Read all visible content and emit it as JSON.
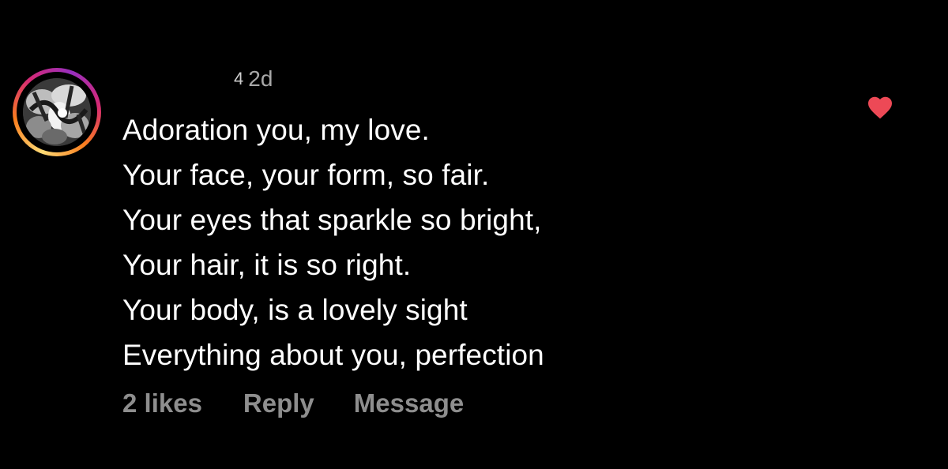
{
  "comment": {
    "username_fragment": "4",
    "timestamp": "2d",
    "lines": [
      "Adoration you, my love.",
      "Your face, your form, so fair.",
      "Your eyes that sparkle so bright,",
      "Your hair, it is so right.",
      "Your body, is a lovely sight",
      "Everything about you, perfection"
    ],
    "actions": {
      "likes_label": "2 likes",
      "reply_label": "Reply",
      "message_label": "Message"
    },
    "liked": true,
    "icons": {
      "like": "heart-filled-icon",
      "avatar": "avatar-image"
    },
    "colors": {
      "heart": "#ed4956",
      "background": "#000000",
      "text": "#ffffff",
      "secondary_text": "#8e8e8e"
    }
  }
}
